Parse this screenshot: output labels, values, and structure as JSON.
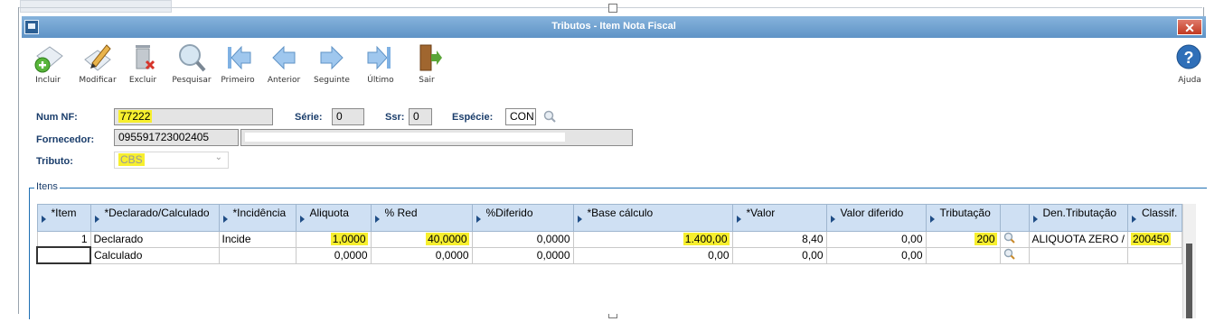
{
  "window": {
    "title": "Tributos - Item Nota Fiscal",
    "close_label": "✕"
  },
  "toolbar": {
    "incluir": "Incluir",
    "modificar": "Modificar",
    "excluir": "Excluir",
    "pesquisar": "Pesquisar",
    "primeiro": "Primeiro",
    "anterior": "Anterior",
    "seguinte": "Seguinte",
    "ultimo": "Último",
    "sair": "Sair",
    "ajuda": "Ajuda"
  },
  "form": {
    "num_nf_label": "Num NF:",
    "num_nf_value": "77222",
    "serie_label": "Série:",
    "serie_value": "0",
    "ssr_label": "Ssr:",
    "ssr_value": "0",
    "especie_label": "Espécie:",
    "especie_value": "CON",
    "fornecedor_label": "Fornecedor:",
    "fornecedor_code": "095591723002405",
    "fornecedor_name": "",
    "tributo_label": "Tributo:",
    "tributo_value": "CBS"
  },
  "itens": {
    "group_title": "Itens",
    "columns": [
      "*Item",
      "*Declarado/Calculado",
      "*Incidência",
      "Aliquota",
      "% Red",
      "%Diferido",
      "*Base cálculo",
      "*Valor",
      "Valor diferido",
      "Tributação",
      "",
      "Den.Tributação",
      "Classif."
    ],
    "rows": [
      {
        "item": "1",
        "declarado": "Declarado",
        "incidencia": "Incide",
        "aliquota": "1,0000",
        "red": "40,0000",
        "diferido": "0,0000",
        "base": "1.400,00",
        "valor": "8,40",
        "valor_diferido": "0,00",
        "tributacao": "200",
        "den_tributacao": "ALIQUOTA ZERO /",
        "classif": "200450"
      },
      {
        "item": "",
        "declarado": "Calculado",
        "incidencia": "",
        "aliquota": "0,0000",
        "red": "0,0000",
        "diferido": "0,0000",
        "base": "0,00",
        "valor": "0,00",
        "valor_diferido": "0,00",
        "tributacao": "",
        "den_tributacao": "",
        "classif": ""
      }
    ]
  },
  "colors": {
    "title_bar": "#6f9fd0",
    "highlight": "#f7ef2e",
    "header_bg": "#cfe0f3",
    "label_color": "#1a3d6b"
  }
}
